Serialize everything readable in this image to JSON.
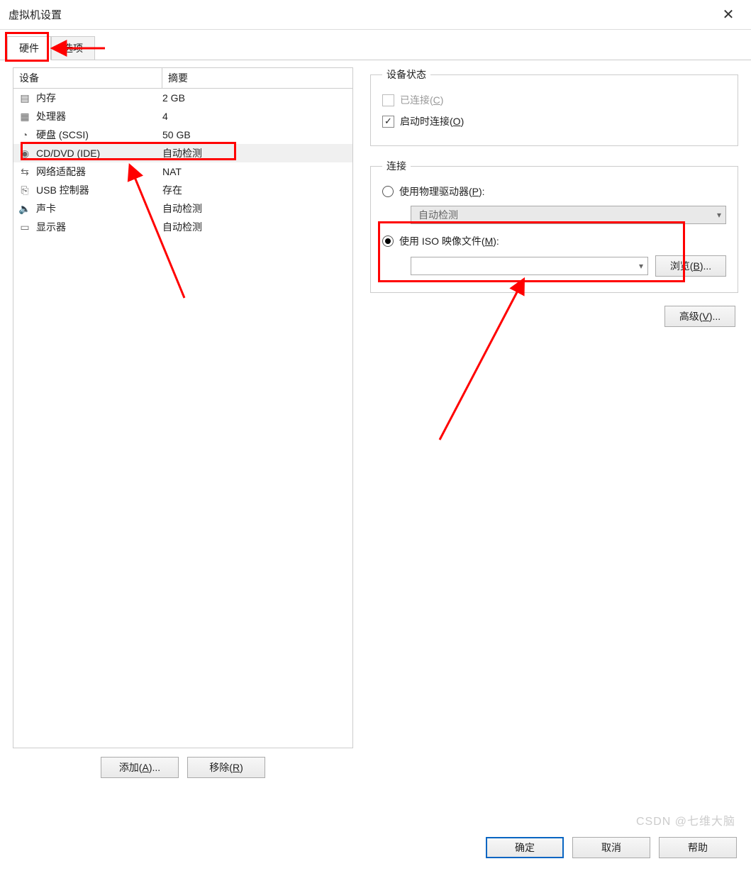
{
  "window": {
    "title": "虚拟机设置"
  },
  "tabs": {
    "hardware": "硬件",
    "options": "选项"
  },
  "table": {
    "header_device": "设备",
    "header_summary": "摘要",
    "rows": [
      {
        "icon": "memory-icon",
        "name": "内存",
        "summary": "2 GB"
      },
      {
        "icon": "cpu-icon",
        "name": "处理器",
        "summary": "4"
      },
      {
        "icon": "disk-icon",
        "name": "硬盘 (SCSI)",
        "summary": "50 GB"
      },
      {
        "icon": "cd-icon",
        "name": "CD/DVD (IDE)",
        "summary": "自动检测"
      },
      {
        "icon": "nic-icon",
        "name": "网络适配器",
        "summary": "NAT"
      },
      {
        "icon": "usb-icon",
        "name": "USB 控制器",
        "summary": "存在"
      },
      {
        "icon": "sound-icon",
        "name": "声卡",
        "summary": "自动检测"
      },
      {
        "icon": "display-icon",
        "name": "显示器",
        "summary": "自动检测"
      }
    ],
    "selected_index": 3
  },
  "left_buttons": {
    "add": "添加(A)...",
    "remove": "移除(R)"
  },
  "status_group": {
    "legend": "设备状态",
    "connected_label": "已连接(C)",
    "connected_checked": false,
    "connected_enabled": false,
    "poweron_label": "启动时连接(O)",
    "poweron_checked": true
  },
  "conn_group": {
    "legend": "连接",
    "physical_label": "使用物理驱动器(P):",
    "physical_selected": false,
    "physical_select_value": "自动检测",
    "iso_label": "使用 ISO 映像文件(M):",
    "iso_selected": true,
    "iso_path": "",
    "browse": "浏览(B)..."
  },
  "advanced": "高级(V)...",
  "footer": {
    "ok": "确定",
    "cancel": "取消",
    "help": "帮助"
  },
  "watermark": "CSDN @七维大脑",
  "icons": {
    "memory-icon": "▤",
    "cpu-icon": "▦",
    "disk-icon": "◔",
    "cd-icon": "◉",
    "nic-icon": "⇆",
    "usb-icon": "⎘",
    "sound-icon": "🔈",
    "display-icon": "▭"
  }
}
